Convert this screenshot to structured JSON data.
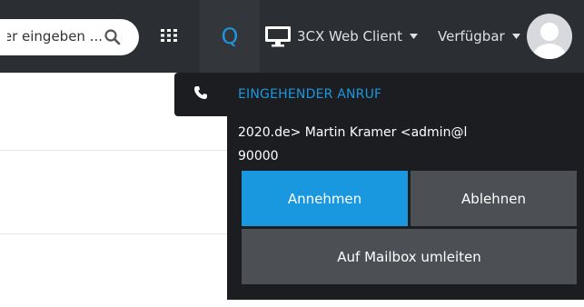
{
  "header": {
    "search": {
      "value": "ner eingeben ..."
    },
    "q_label": "Q",
    "client_label": "3CX Web Client",
    "status_label": "Verfügbar"
  },
  "call_popup": {
    "title": "EINGEHENDER ANRUF",
    "caller": "2020.de> Martin Kramer <admin@l",
    "number": "90000",
    "accept_label": "Annehmen",
    "decline_label": "Ablehnen",
    "voicemail_label": "Auf Mailbox umleiten"
  },
  "colors": {
    "topbar": "#2b2f34",
    "accent": "#1a98df",
    "popup_bg": "#1b1d20",
    "secondary_button": "#4c5054"
  },
  "icons": [
    "search-icon",
    "apps-grid-icon",
    "monitor-icon",
    "chevron-down-icon",
    "avatar-icon",
    "phone-icon"
  ]
}
